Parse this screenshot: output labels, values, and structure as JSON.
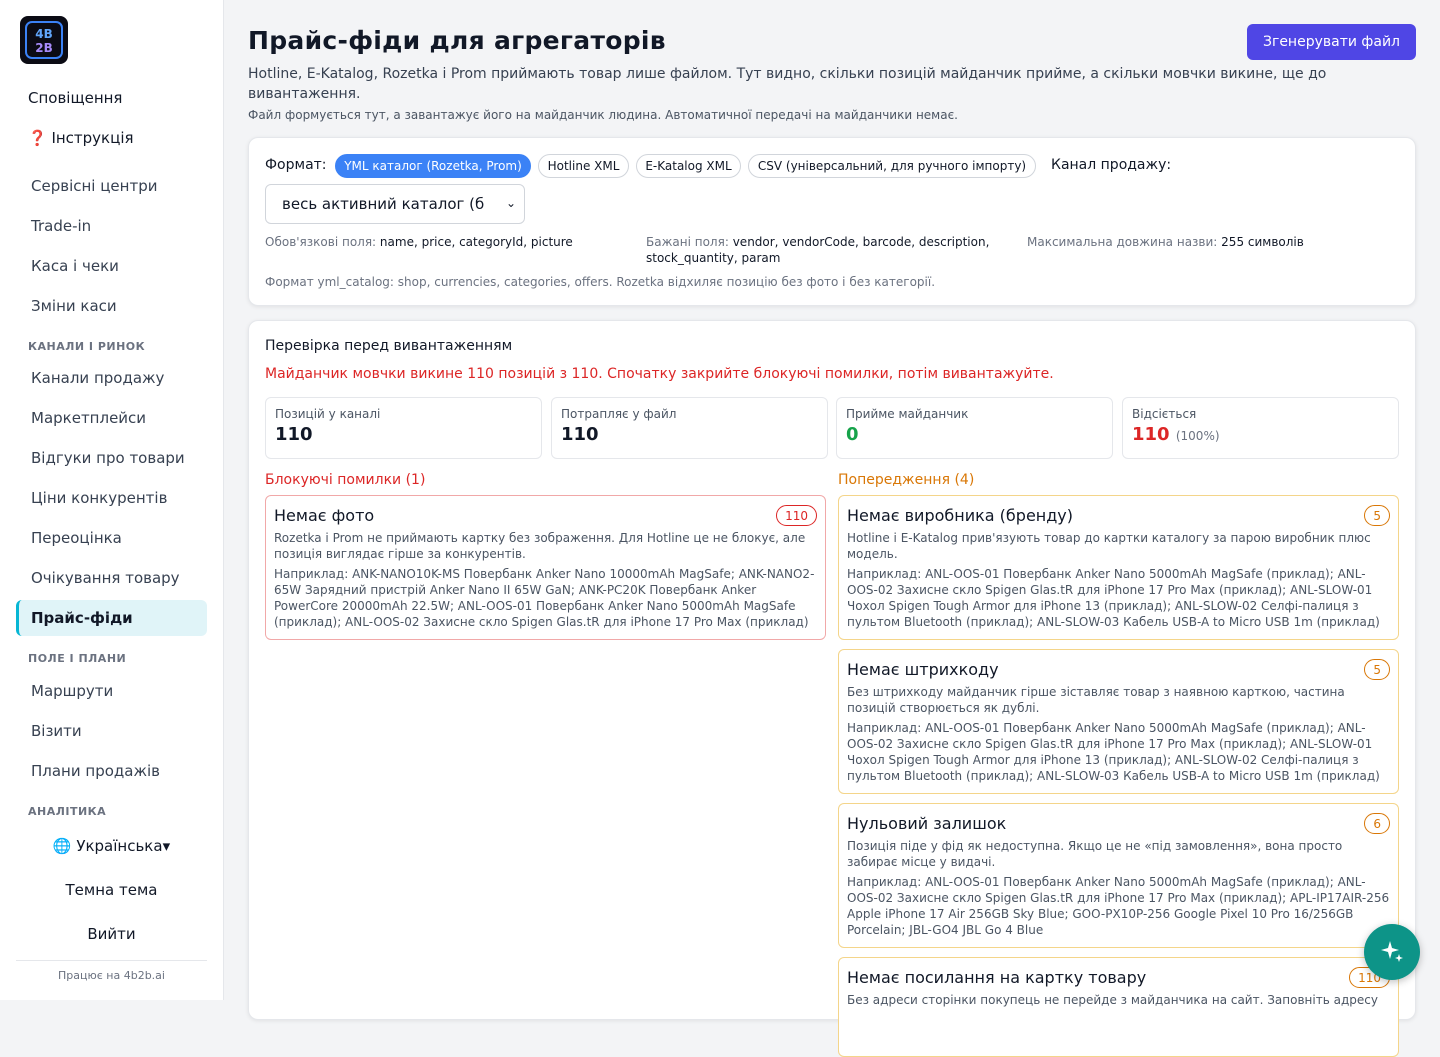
{
  "sidebar": {
    "top_items": [
      {
        "label": "Сповіщення"
      },
      {
        "label": "❓ Інструкція"
      }
    ],
    "group1": [
      "Сервісні центри",
      "Trade-in",
      "Каса і чеки",
      "Зміни каси"
    ],
    "section_market": "КАНАЛИ І РИНОК",
    "group2": [
      "Канали продажу",
      "Маркетплейси",
      "Відгуки про товари",
      "Ціни конкурентів",
      "Переоцінка",
      "Очікування товару",
      "Прайс-фіди"
    ],
    "active": "Прайс-фіди",
    "section_field": "ПОЛЕ І ПЛАНИ",
    "group3": [
      "Маршрути",
      "Візити",
      "Плани продажів"
    ],
    "section_analytics": "АНАЛІТИКА",
    "language": "🌐 Українська▾",
    "theme": "Темна тема",
    "logout": "Вийти",
    "powered": "Працює на 4b2b.ai"
  },
  "header": {
    "title": "Прайс-фіди для агрегаторів",
    "generate_button": "Згенерувати файл",
    "description": "Hotline, E-Katalog, Rozetka і Prom приймають товар лише файлом. Тут видно, скільки позицій майданчик прийме, а скільки мовчки викине, ще до вивантаження.",
    "note": "Файл формується тут, а завантажує його на майданчик людина. Автоматичної передачі на майданчики немає."
  },
  "format": {
    "label": "Формат:",
    "options": [
      "YML каталог (Rozetka, Prom)",
      "Hotline XML",
      "E-Katalog XML",
      "CSV (універсальний, для ручного імпорту)"
    ],
    "selected": "YML каталог (Rozetka, Prom)",
    "channel_label": "Канал продажу:",
    "channel_value": "весь активний каталог (б",
    "required_label": "Обов'язкові поля:",
    "required_value": "name, price, categoryId, picture",
    "desired_label": "Бажані поля:",
    "desired_value": "vendor, vendorCode, barcode, description, stock_quantity, param",
    "maxlen_label": "Максимальна довжина назви:",
    "maxlen_value": "255 символів",
    "yml_note": "Формат yml_catalog: shop, currencies, categories, offers. Rozetka відхиляє позицію без фото і без категорії."
  },
  "check": {
    "title": "Перевірка перед вивантаженням",
    "warning": "Майданчик мовчки викине 110 позицій з 110. Спочатку закрийте блокуючі помилки, потім вивантажуйте.",
    "stats": [
      {
        "label": "Позицій у каналі",
        "value": "110",
        "color": "#111827"
      },
      {
        "label": "Потрапляє у файл",
        "value": "110",
        "color": "#111827"
      },
      {
        "label": "Прийме майданчик",
        "value": "0",
        "color": "#16a34a"
      },
      {
        "label": "Відсіється",
        "value": "110",
        "pct": "(100%)",
        "color": "#dc2626"
      }
    ],
    "blocking_header": "Блокуючі помилки (1)",
    "warnings_header": "Попередження (4)",
    "blocking": [
      {
        "title": "Немає фото",
        "count": "110",
        "desc": "Rozetka і Prom не приймають картку без зображення. Для Hotline це не блокує, але позиція виглядає гірше за конкурентів.",
        "example": "Наприклад: ANK-NANO10K-MS Повербанк Anker Nano 10000mAh MagSafe; ANK-NANO2-65W Зарядний пристрій Anker Nano II 65W GaN; ANK-PC20K Повербанк Anker PowerCore 20000mAh 22.5W; ANL-OOS-01 Повербанк Anker Nano 5000mAh MagSafe (приклад); ANL-OOS-02 Захисне скло Spigen Glas.tR для iPhone 17 Pro Max (приклад)"
      }
    ],
    "warnings": [
      {
        "title": "Немає виробника (бренду)",
        "count": "5",
        "desc": "Hotline і E-Katalog прив'язують товар до картки каталогу за парою виробник плюс модель.",
        "example": "Наприклад: ANL-OOS-01 Повербанк Anker Nano 5000mAh MagSafe (приклад); ANL-OOS-02 Захисне скло Spigen Glas.tR для iPhone 17 Pro Max (приклад); ANL-SLOW-01 Чохол Spigen Tough Armor для iPhone 13 (приклад); ANL-SLOW-02 Селфі-палиця з пультом Bluetooth (приклад); ANL-SLOW-03 Кабель USB-A to Micro USB 1m (приклад)"
      },
      {
        "title": "Немає штрихкоду",
        "count": "5",
        "desc": "Без штрихкоду майданчик гірше зіставляє товар з наявною карткою, частина позицій створюється як дублі.",
        "example": "Наприклад: ANL-OOS-01 Повербанк Anker Nano 5000mAh MagSafe (приклад); ANL-OOS-02 Захисне скло Spigen Glas.tR для iPhone 17 Pro Max (приклад); ANL-SLOW-01 Чохол Spigen Tough Armor для iPhone 13 (приклад); ANL-SLOW-02 Селфі-палиця з пультом Bluetooth (приклад); ANL-SLOW-03 Кабель USB-A to Micro USB 1m (приклад)"
      },
      {
        "title": "Нульовий залишок",
        "count": "6",
        "desc": "Позиція піде у фід як недоступна. Якщо це не «під замовлення», вона просто забирає місце у видачі.",
        "example": "Наприклад: ANL-OOS-01 Повербанк Anker Nano 5000mAh MagSafe (приклад); ANL-OOS-02 Захисне скло Spigen Glas.tR для iPhone 17 Pro Max (приклад); APL-IP17AIR-256 Apple iPhone 17 Air 256GB Sky Blue; GOO-PX10P-256 Google Pixel 10 Pro 16/256GB Porcelain; JBL-GO4 JBL Go 4 Blue"
      },
      {
        "title": "Немає посилання на картку товару",
        "count": "110",
        "desc": "Без адреси сторінки покупець не перейде з майданчика на сайт. Заповніть адресу",
        "example": ""
      }
    ]
  },
  "colors": {
    "accent": "#4f46e5",
    "pill_active": "#3b82f6",
    "error": "#dc2626",
    "warning": "#d97706",
    "fab": "#0d9488"
  },
  "icons": {
    "logo": "4b2b-logo",
    "fab": "sparkle-icon"
  }
}
